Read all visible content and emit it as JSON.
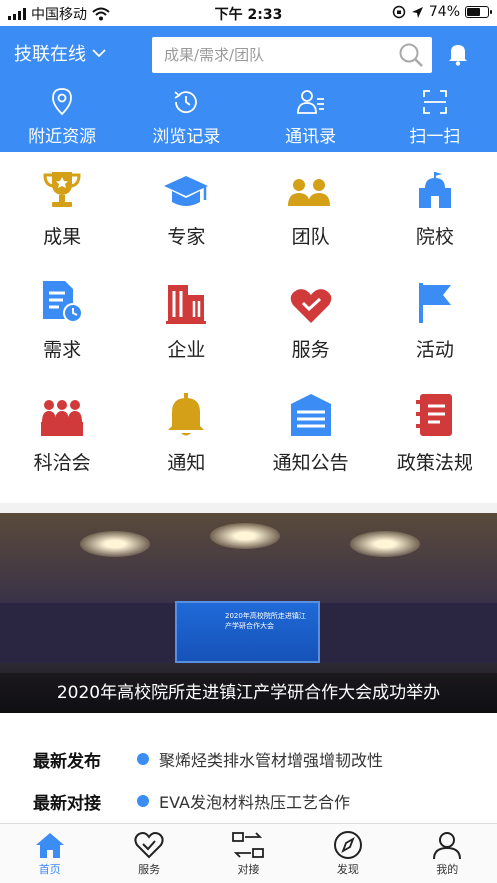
{
  "status_bar": {
    "carrier": "中国移动",
    "time": "下午 2:33",
    "battery": "74%",
    "battery_level": 0.74
  },
  "header": {
    "city": "技联在线",
    "search_placeholder": "成果/需求/团队",
    "quick": [
      {
        "label": "附近资源",
        "icon": "location-icon"
      },
      {
        "label": "浏览记录",
        "icon": "history-icon"
      },
      {
        "label": "通讯录",
        "icon": "contacts-icon"
      },
      {
        "label": "扫一扫",
        "icon": "scan-icon"
      }
    ]
  },
  "grid": [
    {
      "label": "成果",
      "icon": "trophy-icon",
      "color": "#d4a017"
    },
    {
      "label": "专家",
      "icon": "graduation-cap-icon",
      "color": "#3b8cf4"
    },
    {
      "label": "团队",
      "icon": "team-icon",
      "color": "#d4a017"
    },
    {
      "label": "院校",
      "icon": "school-icon",
      "color": "#3b8cf4"
    },
    {
      "label": "需求",
      "icon": "document-clock-icon",
      "color": "#3b8cf4"
    },
    {
      "label": "企业",
      "icon": "building-icon",
      "color": "#d13a3a"
    },
    {
      "label": "服务",
      "icon": "heart-icon",
      "color": "#d13a3a"
    },
    {
      "label": "活动",
      "icon": "flag-icon",
      "color": "#3b8cf4"
    },
    {
      "label": "科洽会",
      "icon": "meeting-icon",
      "color": "#d13a3a"
    },
    {
      "label": "通知",
      "icon": "bell-icon",
      "color": "#d4a017"
    },
    {
      "label": "通知公告",
      "icon": "notice-board-icon",
      "color": "#3b8cf4"
    },
    {
      "label": "政策法规",
      "icon": "book-icon",
      "color": "#d13a3a"
    }
  ],
  "banner": {
    "caption": "2020年高校院所走进镇江产学研合作大会成功举办",
    "screen_title": "2020年高校院所走进镇江",
    "screen_subtitle": "产学研合作大会"
  },
  "news": [
    {
      "key": "最新发布",
      "value": "聚烯烃类排水管材增强增韧改性"
    },
    {
      "key": "最新对接",
      "value": "EVA发泡材料热压工艺合作"
    }
  ],
  "tabbar": [
    {
      "label": "首页",
      "icon": "home-icon",
      "active": true
    },
    {
      "label": "服务",
      "icon": "heart-outline-icon",
      "active": false
    },
    {
      "label": "对接",
      "icon": "exchange-icon",
      "active": false
    },
    {
      "label": "发现",
      "icon": "compass-icon",
      "active": false
    },
    {
      "label": "我的",
      "icon": "user-icon",
      "active": false
    }
  ],
  "colors": {
    "primary": "#3b8cf4",
    "gold": "#d4a017",
    "red": "#d13a3a"
  }
}
